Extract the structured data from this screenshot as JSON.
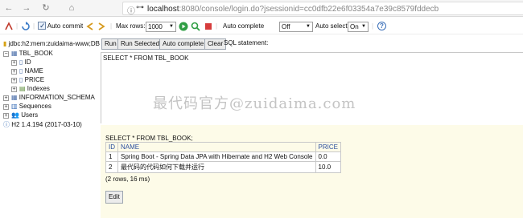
{
  "browser": {
    "url_host": "localhost",
    "url_path": ":8080/console/login.do?jsessionid=cc0dfb22e6f03354a7e39c8579fddecb"
  },
  "toolbar": {
    "auto_commit_label": "Auto commit",
    "max_rows_label": "Max rows:",
    "max_rows_value": "1000",
    "auto_complete_label": "Auto complete",
    "auto_complete_value": "Off",
    "auto_select_label": "Auto select",
    "auto_select_value": "On",
    "help_icon": "?"
  },
  "tree": {
    "connection": "jdbc:h2:mem:zuidaima-www;DB",
    "table": "TBL_BOOK",
    "columns": [
      "ID",
      "NAME",
      "PRICE"
    ],
    "indexes": "Indexes",
    "info_schema": "INFORMATION_SCHEMA",
    "sequences": "Sequences",
    "users": "Users",
    "version": "H2 1.4.194 (2017-03-10)"
  },
  "buttons": {
    "run": "Run",
    "run_selected": "Run Selected",
    "auto_complete": "Auto complete",
    "clear": "Clear",
    "sql_statement": "SQL statement:"
  },
  "sql": "SELECT * FROM TBL_BOOK",
  "watermark": "最代码官方@zuidaima.com",
  "result": {
    "statement": "SELECT * FROM TBL_BOOK;",
    "headers": [
      "ID",
      "NAME",
      "PRICE"
    ],
    "rows": [
      [
        "1",
        "Spring Boot - Spring Data JPA with Hibernate and H2 Web Console",
        "0.0"
      ],
      [
        "2",
        "最代码的代码如何下载并运行",
        "10.0"
      ]
    ],
    "summary": "(2 rows, 16 ms)",
    "edit_label": "Edit"
  }
}
